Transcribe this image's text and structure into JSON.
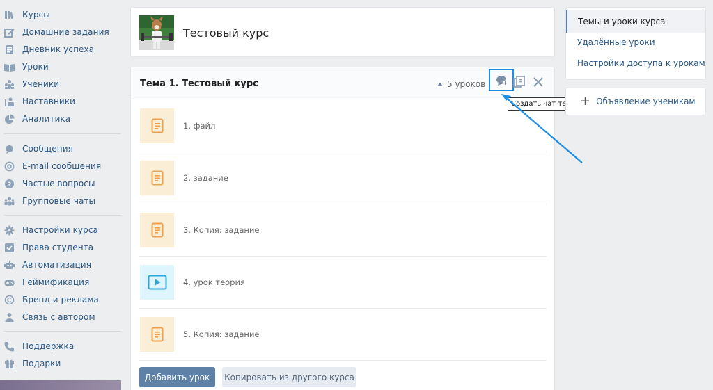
{
  "sidebar": {
    "items": [
      {
        "label": "Курсы",
        "icon": "courses-icon"
      },
      {
        "label": "Домашние задания",
        "icon": "edit-icon"
      },
      {
        "label": "Дневник успеха",
        "icon": "diary-icon"
      },
      {
        "label": "Уроки",
        "icon": "book-icon"
      },
      {
        "label": "Ученики",
        "icon": "students-icon"
      },
      {
        "label": "Наставники",
        "icon": "mentors-icon"
      },
      {
        "label": "Аналитика",
        "icon": "pie-chart-icon"
      },
      {
        "label": "Сообщения",
        "icon": "messages-icon"
      },
      {
        "label": "E-mail сообщения",
        "icon": "at-icon"
      },
      {
        "label": "Частые вопросы",
        "icon": "question-icon"
      },
      {
        "label": "Групповые чаты",
        "icon": "group-icon"
      },
      {
        "label": "Настройки курса",
        "icon": "gear-icon"
      },
      {
        "label": "Права студента",
        "icon": "checkbox-icon"
      },
      {
        "label": "Автоматизация",
        "icon": "robot-icon"
      },
      {
        "label": "Геймификация",
        "icon": "gamepad-icon"
      },
      {
        "label": "Бренд и реклама",
        "icon": "copyright-icon"
      },
      {
        "label": "Связь с автором",
        "icon": "person-icon"
      },
      {
        "label": "Поддержка",
        "icon": "phone-icon"
      },
      {
        "label": "Подарки",
        "icon": "gift-icon"
      }
    ]
  },
  "course": {
    "title": "Тестовый курс"
  },
  "topic": {
    "title": "Тема 1. Тестовый курс",
    "lesson_count": "5 уроков",
    "tooltip": "Создать чат темы",
    "lessons": [
      {
        "label": "1. файл",
        "type": "document"
      },
      {
        "label": "2. задание",
        "type": "document"
      },
      {
        "label": "3. Копия: задание",
        "type": "document"
      },
      {
        "label": "4. урок теория",
        "type": "video"
      },
      {
        "label": "5. Копия: задание",
        "type": "document"
      }
    ],
    "add_lesson_label": "Добавить урок",
    "copy_from_course_label": "Копировать из другого курса"
  },
  "right_menu": {
    "items": [
      {
        "label": "Темы и уроки курса",
        "active": true
      },
      {
        "label": "Удалённые уроки",
        "active": false
      },
      {
        "label": "Настройки доступа к урокам",
        "active": false
      }
    ],
    "announce_label": "Объявление ученикам"
  },
  "colors": {
    "link": "#2a5885",
    "accent_blue": "#1b8ee6",
    "primary_button": "#5e81a8",
    "doc_thumb_bg": "#fbeed6",
    "doc_icon": "#f0a04b",
    "video_thumb_bg": "#dff5fd",
    "video_icon": "#29a7dc",
    "sidebar_icon": "#8fa3b8"
  }
}
